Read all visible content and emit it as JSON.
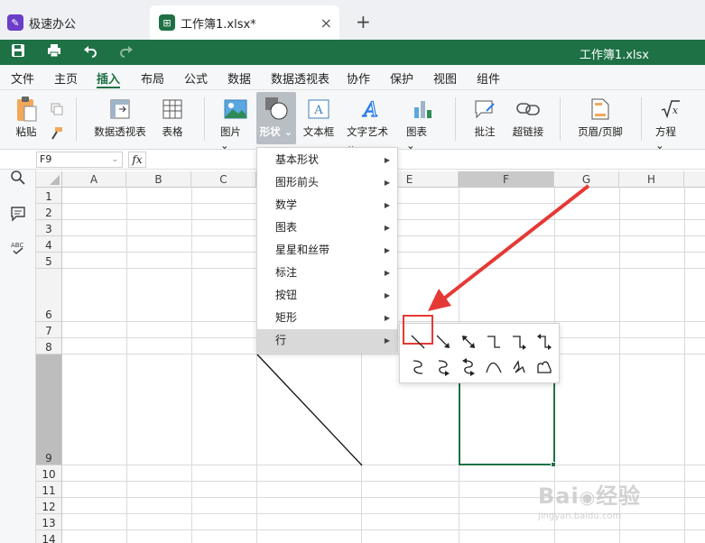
{
  "tabs": {
    "app": "极速办公",
    "doc": "工作簿1.xlsx*",
    "close": "×",
    "new": "+"
  },
  "quickbar": {
    "title": "工作簿1.xlsx"
  },
  "menu": [
    "文件",
    "主页",
    "插入",
    "布局",
    "公式",
    "数据",
    "数据透视表",
    "协作",
    "保护",
    "视图",
    "组件"
  ],
  "ribbon": {
    "paste": "粘贴",
    "pivot": "数据透视表",
    "table": "表格",
    "picture": "图片",
    "shape": "形状",
    "textbox": "文本框",
    "wordart": "文字艺术",
    "chart": "图表",
    "comment": "批注",
    "hyperlink": "超链接",
    "header": "页眉/页脚",
    "equation": "方程"
  },
  "formula": {
    "cell": "F9",
    "fx": "fx"
  },
  "columns": [
    "A",
    "B",
    "C",
    "D",
    "E",
    "F",
    "G",
    "H"
  ],
  "rows": [
    "1",
    "2",
    "3",
    "4",
    "5",
    "6",
    "7",
    "8",
    "9",
    "10",
    "11",
    "12",
    "13",
    "14"
  ],
  "dropdown": [
    "基本形状",
    "图形前头",
    "数学",
    "图表",
    "星星和丝带",
    "标注",
    "按钮",
    "矩形",
    "行"
  ],
  "submenu_icons": [
    "line",
    "arrow",
    "double-arrow",
    "elbow",
    "elbow-arrow",
    "elbow-double-arrow",
    "curve",
    "curve-arrow",
    "curve-double-arrow",
    "arc",
    "freeform",
    "scribble"
  ],
  "colors": {
    "accent": "#1e7145",
    "highlight": "#e53935"
  }
}
